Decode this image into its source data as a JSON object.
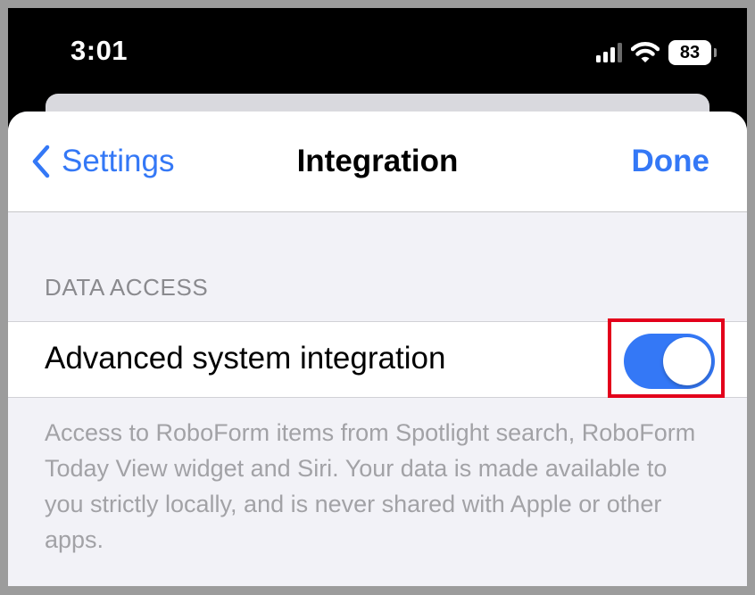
{
  "status_bar": {
    "time": "3:01",
    "battery": "83",
    "signal_bars_active": 3,
    "signal_bars_total": 4
  },
  "nav": {
    "back_label": "Settings",
    "title": "Integration",
    "done_label": "Done"
  },
  "section": {
    "header": "DATA ACCESS",
    "row_label": "Advanced system integration",
    "toggle_on": true,
    "footer": "Access to RoboForm items from Spotlight search, RoboForm Today View widget and Siri. Your data is made available to you strictly locally, and is never shared with Apple or other apps."
  },
  "colors": {
    "accent": "#3478f6",
    "highlight": "#e3001b",
    "background": "#f2f2f7"
  },
  "icons": {
    "back": "chevron-left-icon",
    "signal": "cellular-signal-icon",
    "wifi": "wifi-icon",
    "battery": "battery-icon"
  }
}
